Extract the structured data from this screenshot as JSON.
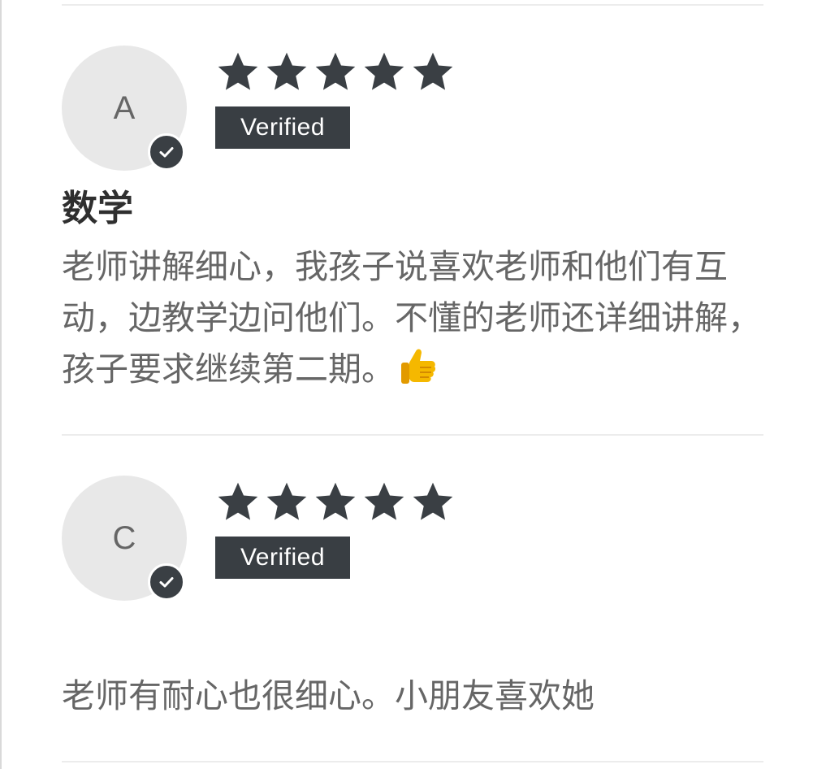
{
  "reviews": [
    {
      "avatar_letter": "A",
      "rating": 5,
      "badge": "Verified",
      "title": "数学",
      "body": "老师讲解细心，我孩子说喜欢老师和他们有互动，边教学边问他们。不懂的老师还详细讲解，孩子要求继续第二期。",
      "emoji": "thumbs-up-emoji"
    },
    {
      "avatar_letter": "C",
      "rating": 5,
      "badge": "Verified",
      "title": "",
      "body": "老师有耐心也很细心。小朋友喜欢她"
    }
  ],
  "colors": {
    "star": "#3a3f44",
    "badge_bg": "#393e43",
    "avatar_bg": "#e8e8e8",
    "body_text": "#666666",
    "emoji": "#f5b800"
  }
}
